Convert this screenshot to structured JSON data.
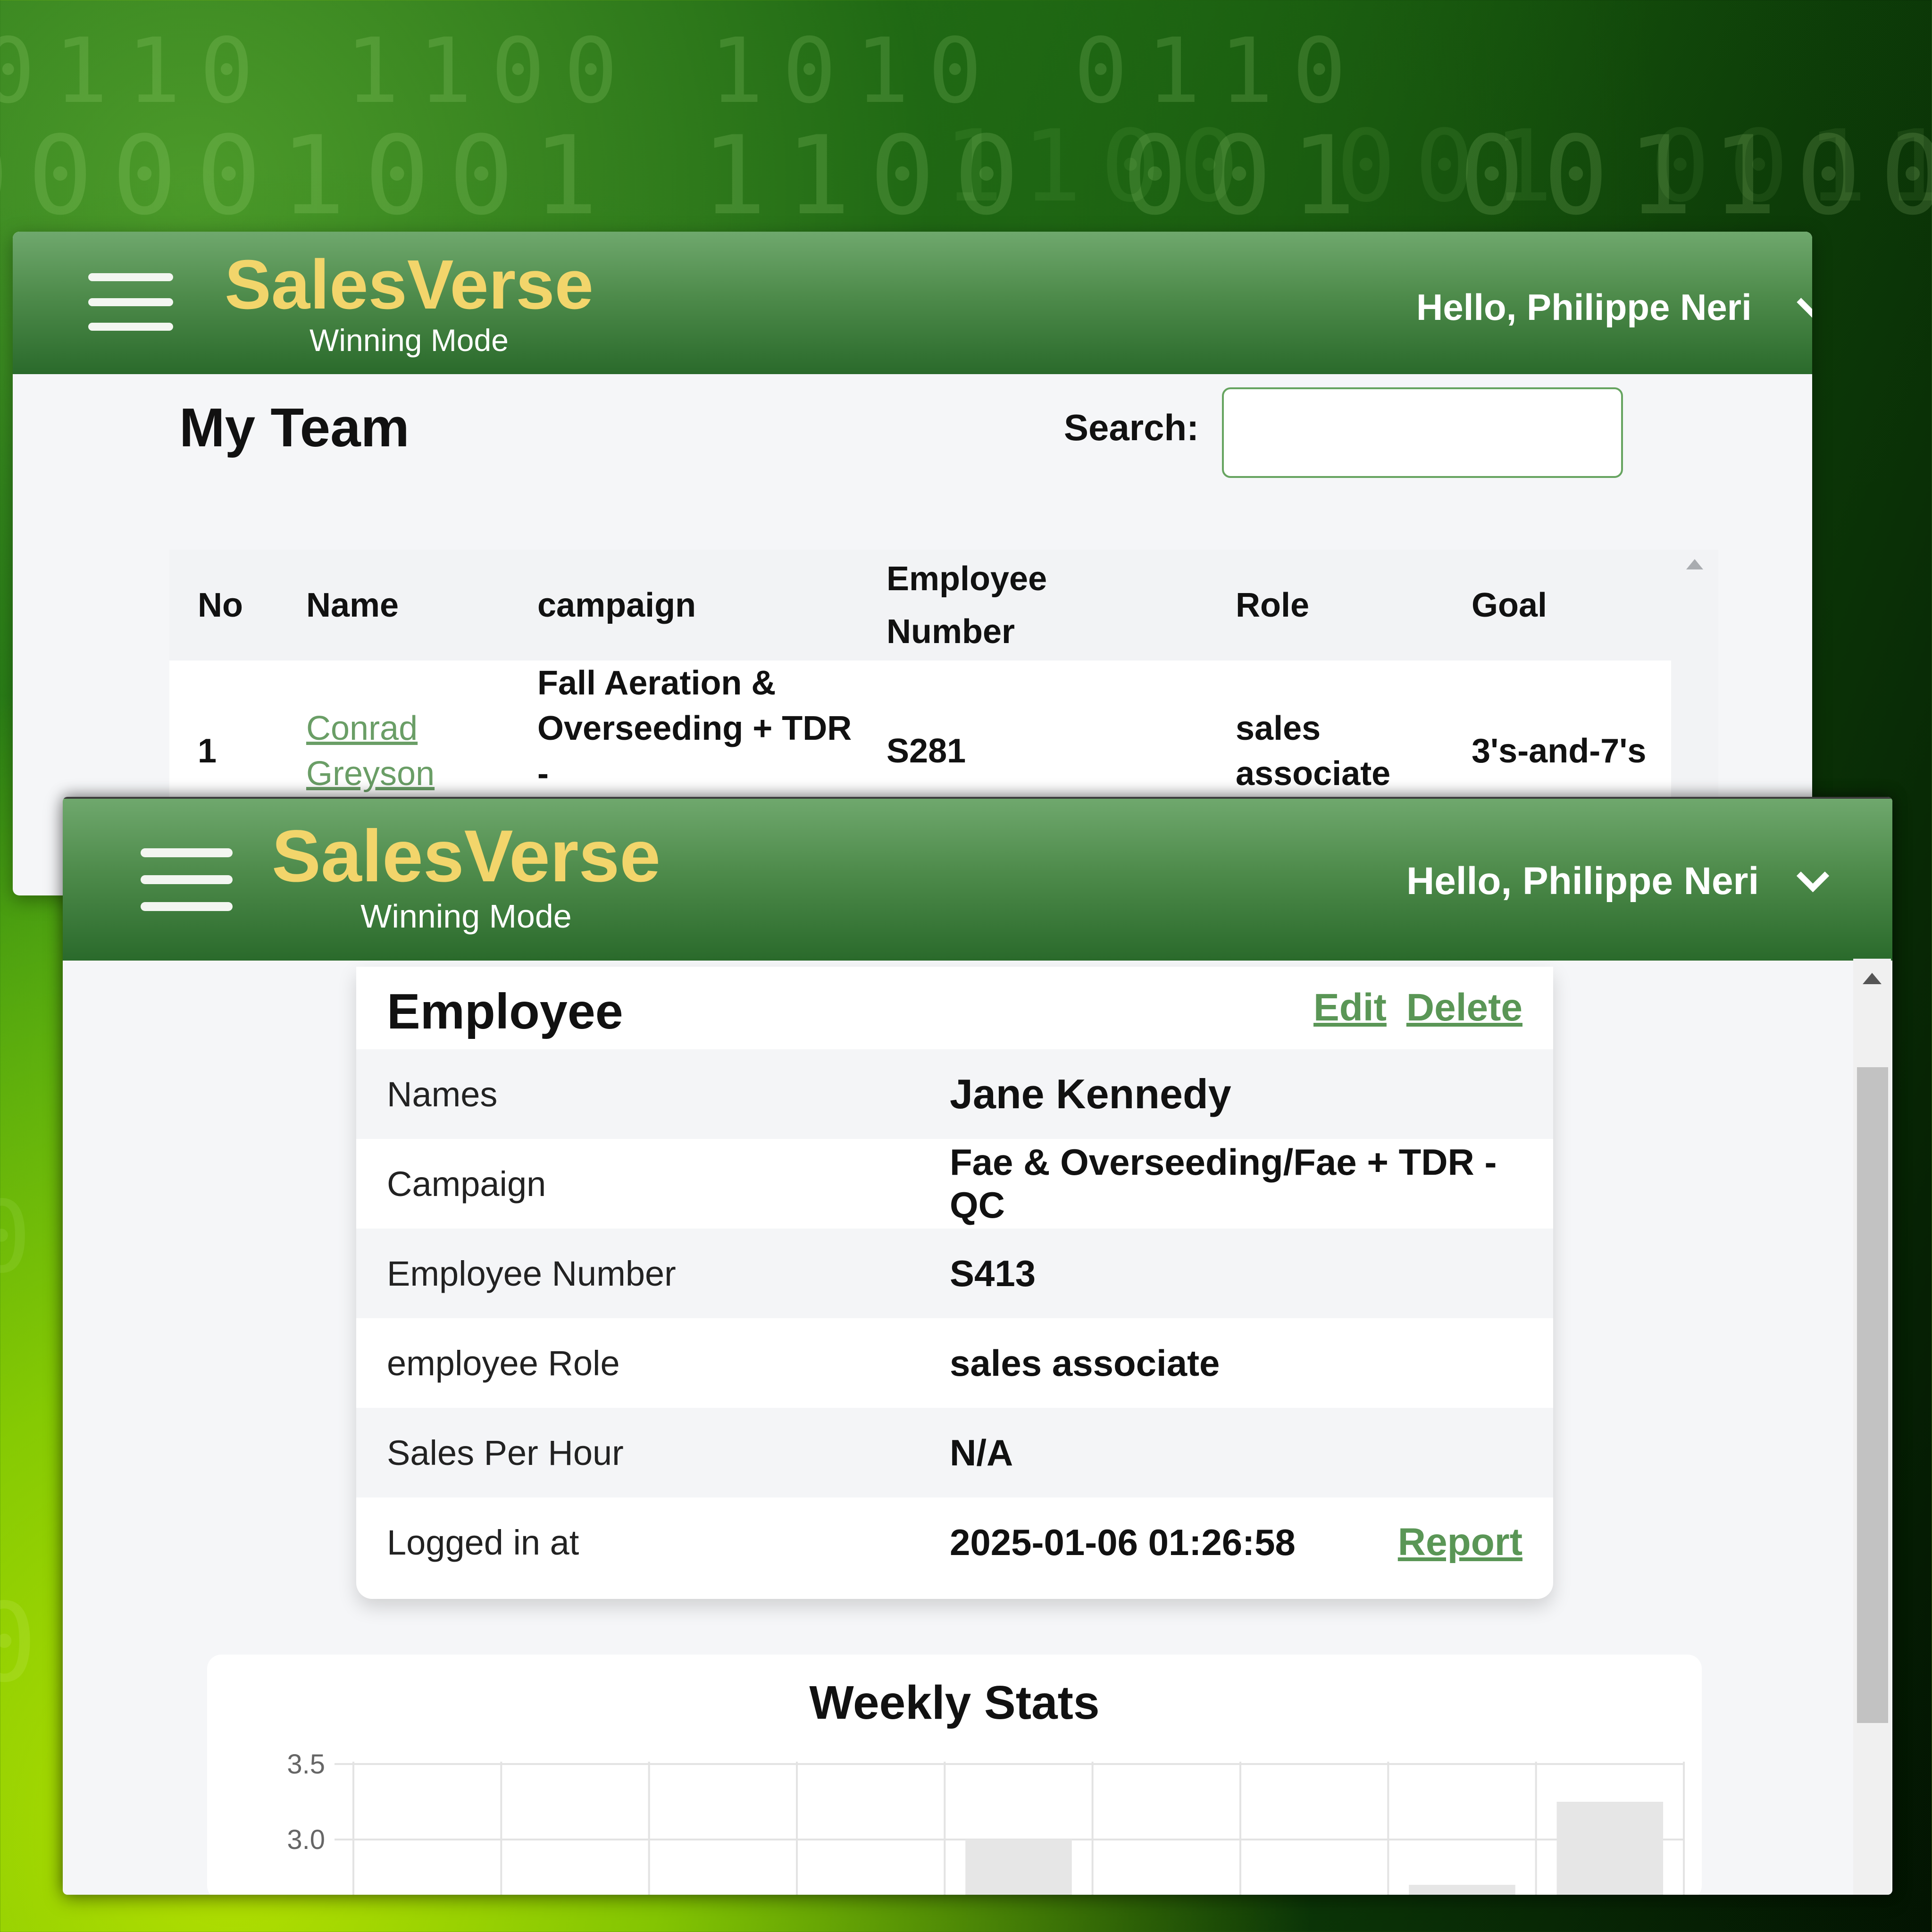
{
  "app": {
    "brand": "SalesVerse",
    "tagline": "Winning Mode",
    "greeting": "Hello, Philippe Neri",
    "accent_color": "#5a9656",
    "brand_color": "#f2d56b",
    "header_color": "#2a6a2b",
    "icons": {
      "menu": "hamburger-icon",
      "dropdown": "chevron-down-icon"
    }
  },
  "team_page": {
    "title": "My Team",
    "search_label": "Search:",
    "search_value": "",
    "columns": [
      "No",
      "Name",
      "campaign",
      "Employee\nNumber",
      "Role",
      "Goal"
    ],
    "rows": [
      {
        "no": "1",
        "name": "Conrad\nGreyson",
        "campaign": "Fall Aeration &\nOverseeding + TDR -\nQC",
        "employee_number": "S281",
        "role": "sales\nassociate",
        "goal": "3's-and-7's"
      }
    ]
  },
  "employee_page": {
    "card_title": "Employee",
    "edit_label": "Edit",
    "delete_label": "Delete",
    "fields": [
      {
        "label": "Names",
        "value": "Jane Kennedy"
      },
      {
        "label": "Campaign",
        "value": "Fae & Overseeding/Fae + TDR - QC"
      },
      {
        "label": "Employee Number",
        "value": "S413"
      },
      {
        "label": "employee Role",
        "value": "sales associate"
      },
      {
        "label": "Sales Per Hour",
        "value": "N/A"
      },
      {
        "label": "Logged in at",
        "value": "2025-01-06 01:26:58"
      }
    ],
    "report_label": "Report",
    "stats_title": "Weekly Stats"
  },
  "chart_data": {
    "type": "bar",
    "title": "Weekly Stats",
    "xlabel": "",
    "ylabel": "",
    "y_ticks": [
      "3.5",
      "3.0"
    ],
    "ylim": [
      2.65,
      3.5
    ],
    "grid": true,
    "bar_color": "#e6e6e6",
    "values": [
      null,
      null,
      null,
      null,
      3.0,
      null,
      null,
      2.7,
      3.25
    ]
  }
}
